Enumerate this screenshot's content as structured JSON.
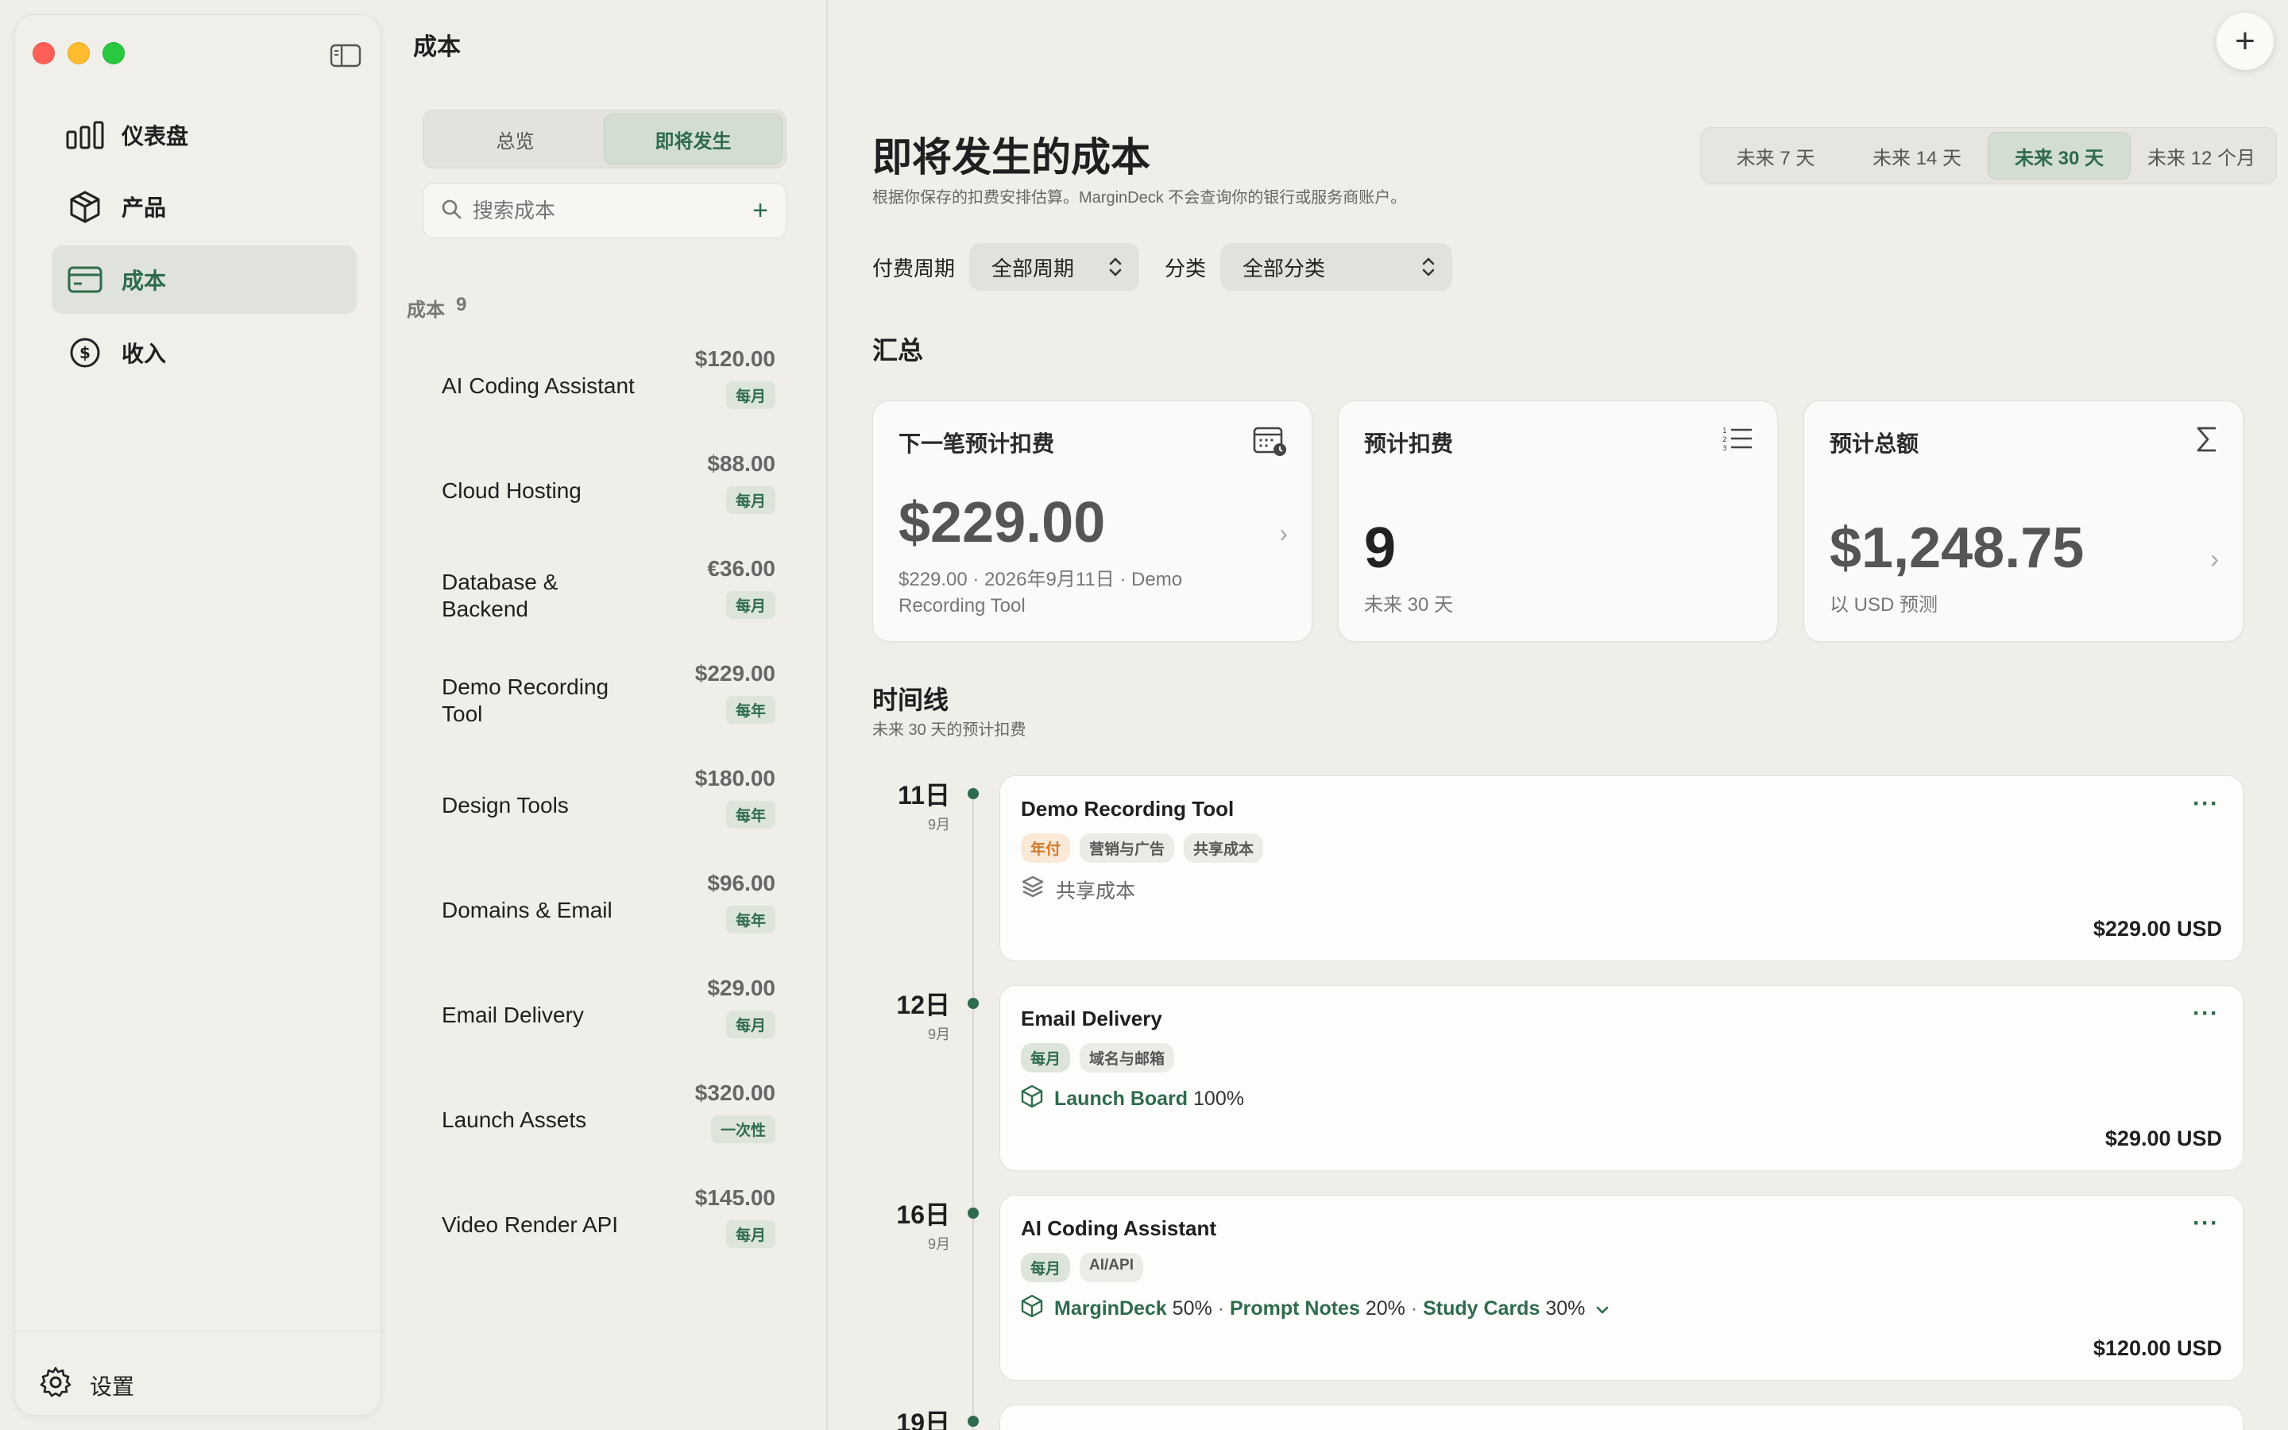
{
  "sidebar": {
    "items": [
      {
        "label": "仪表盘",
        "icon": "bar-chart-icon"
      },
      {
        "label": "产品",
        "icon": "box-icon"
      },
      {
        "label": "成本",
        "icon": "card-icon",
        "active": true
      },
      {
        "label": "收入",
        "icon": "dollar-circle-icon"
      }
    ],
    "settings_label": "设置"
  },
  "list": {
    "title": "成本",
    "tabs": [
      {
        "label": "总览"
      },
      {
        "label": "即将发生",
        "active": true
      }
    ],
    "search_placeholder": "搜索成本",
    "header_label": "成本",
    "header_count": "9",
    "items": [
      {
        "name": "AI Coding Assistant",
        "amount": "$120.00",
        "cycle": "每月"
      },
      {
        "name": "Cloud Hosting",
        "amount": "$88.00",
        "cycle": "每月"
      },
      {
        "name": "Database & Backend",
        "amount": "€36.00",
        "cycle": "每月"
      },
      {
        "name": "Demo Recording Tool",
        "amount": "$229.00",
        "cycle": "每年"
      },
      {
        "name": "Design Tools",
        "amount": "$180.00",
        "cycle": "每年"
      },
      {
        "name": "Domains & Email",
        "amount": "$96.00",
        "cycle": "每年"
      },
      {
        "name": "Email Delivery",
        "amount": "$29.00",
        "cycle": "每月"
      },
      {
        "name": "Launch Assets",
        "amount": "$320.00",
        "cycle": "一次性"
      },
      {
        "name": "Video Render API",
        "amount": "$145.00",
        "cycle": "每月"
      }
    ]
  },
  "main": {
    "title": "即将发生的成本",
    "subtitle": "根据你保存的扣费安排估算。MarginDeck 不会查询你的银行或服务商账户。",
    "ranges": [
      {
        "label": "未来 7 天"
      },
      {
        "label": "未来 14 天"
      },
      {
        "label": "未来 30 天",
        "active": true
      },
      {
        "label": "未来 12 个月"
      }
    ],
    "filters": {
      "cycle_label": "付费周期",
      "cycle_value": "全部周期",
      "category_label": "分类",
      "category_value": "全部分类"
    },
    "summary_title": "汇总",
    "cards": {
      "next": {
        "label": "下一笔预计扣费",
        "value": "$229.00",
        "sub": "$229.00 · 2026年9月11日 · Demo Recording Tool"
      },
      "count": {
        "label": "预计扣费",
        "value": "9",
        "sub": "未来 30 天"
      },
      "total": {
        "label": "预计总额",
        "value": "$1,248.75",
        "sub": "以 USD 预测"
      }
    },
    "timeline_title": "时间线",
    "timeline_subtitle": "未来 30 天的预计扣费",
    "timeline": [
      {
        "day": "11日",
        "month": "9月",
        "name": "Demo Recording Tool",
        "tags": [
          {
            "text": "年付",
            "style": "orange"
          },
          {
            "text": "营销与广告",
            "style": "gray"
          },
          {
            "text": "共享成本",
            "style": "gray"
          }
        ],
        "alloc_text": "共享成本",
        "amount": "$229.00 USD"
      },
      {
        "day": "12日",
        "month": "9月",
        "name": "Email Delivery",
        "tags": [
          {
            "text": "每月",
            "style": "green"
          },
          {
            "text": "域名与邮箱",
            "style": "gray"
          }
        ],
        "alloc_product": "Launch Board",
        "alloc_pct": "100%",
        "amount": "$29.00 USD"
      },
      {
        "day": "16日",
        "month": "9月",
        "name": "AI Coding Assistant",
        "tags": [
          {
            "text": "每月",
            "style": "green"
          },
          {
            "text": "AI/API",
            "style": "gray"
          }
        ],
        "allocs": [
          {
            "product": "MarginDeck",
            "pct": "50%"
          },
          {
            "product": "Prompt Notes",
            "pct": "20%"
          },
          {
            "product": "Study Cards",
            "pct": "30%"
          }
        ],
        "amount": "$120.00 USD"
      },
      {
        "day": "19日"
      }
    ]
  }
}
